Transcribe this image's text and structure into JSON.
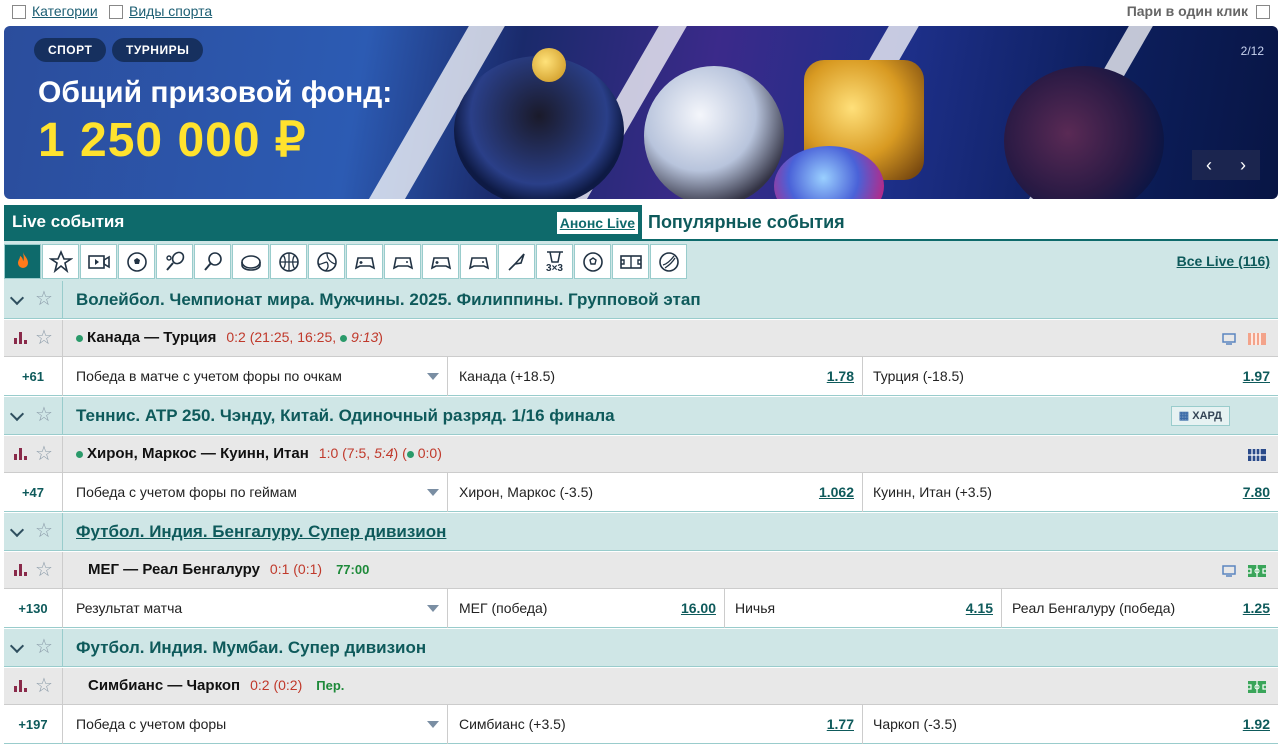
{
  "topbar": {
    "categories_label": "Категории",
    "sports_label": "Виды спорта",
    "one_click_label": "Пари в один клик"
  },
  "banner": {
    "chip_sport": "СПОРТ",
    "chip_tournaments": "ТУРНИРЫ",
    "title": "Общий призовой фонд:",
    "amount": "1 250 000 ₽",
    "counter": "2/12",
    "prev": "‹",
    "next": "›"
  },
  "tabs": {
    "live": "Live события",
    "anons": "Анонс Live",
    "popular": "Популярные события"
  },
  "sports_bar": {
    "icons": [
      "fire-icon",
      "star-icon",
      "video-icon",
      "football-icon",
      "tennis-icon",
      "table-tennis-icon",
      "hockey-icon",
      "basketball-icon",
      "volleyball-icon",
      "esports-icon",
      "esports-icon-2",
      "esports-icon-3",
      "esports-icon-4",
      "badminton-icon",
      "basketball-3x3-icon",
      "futsal-icon",
      "handball-icon",
      "other-sport-icon"
    ],
    "basket_3x3": "3×3",
    "all_live": "Все Live (116)"
  },
  "events": [
    {
      "league": "Волейбол. Чемпионат мира. Мужчины. 2025. Филиппины. Групповой этап",
      "teams": "Канада — Турция",
      "score": "0:2 (21:25, 16:25, ",
      "score_live": "9:13",
      "score_end": ")",
      "plus": "+61",
      "market": "Победа в матче с учетом форы по очкам",
      "outcomes": [
        {
          "name": "Канада  (+18.5)",
          "odd": "1.78"
        },
        {
          "name": "Турция  (-18.5)",
          "odd": "1.97"
        }
      ]
    },
    {
      "league": "Теннис. ATP 250. Чэнду, Китай. Одиночный разряд. 1/16 финала",
      "surface": "ХАРД",
      "teams": "Хирон, Маркос — Куинн, Итан",
      "score": "1:0 (7:5, ",
      "score_live": "5:4",
      "score_end": ") (",
      "score_game": "0:0",
      "score_game_end": ")",
      "plus": "+47",
      "market": "Победа с учетом форы по геймам",
      "outcomes": [
        {
          "name": "Хирон, Маркос  (-3.5)",
          "odd": "1.062"
        },
        {
          "name": "Куинн, Итан  (+3.5)",
          "odd": "7.80"
        }
      ]
    },
    {
      "league": "Футбол. Индия. Бенгалуру. Супер дивизион",
      "teams": "МЕГ — Реал Бенгалуру",
      "score": "0:1 (0:1)",
      "time": "77:00",
      "plus": "+130",
      "market": "Результат матча",
      "outcomes": [
        {
          "name": "МЕГ (победа)",
          "odd": "16.00"
        },
        {
          "name": "Ничья",
          "odd": "4.15"
        },
        {
          "name": "Реал Бенгалуру (победа)",
          "odd": "1.25"
        }
      ]
    },
    {
      "league": "Футбол. Индия. Мумбаи. Супер дивизион",
      "teams": "Симбианс — Чаркоп",
      "score": "0:2 (0:2)",
      "time": "Пер.",
      "plus": "+197",
      "market": "Победа с учетом форы",
      "outcomes": [
        {
          "name": "Симбианс  (+3.5)",
          "odd": "1.77"
        },
        {
          "name": "Чаркоп  (-3.5)",
          "odd": "1.92"
        }
      ]
    }
  ]
}
